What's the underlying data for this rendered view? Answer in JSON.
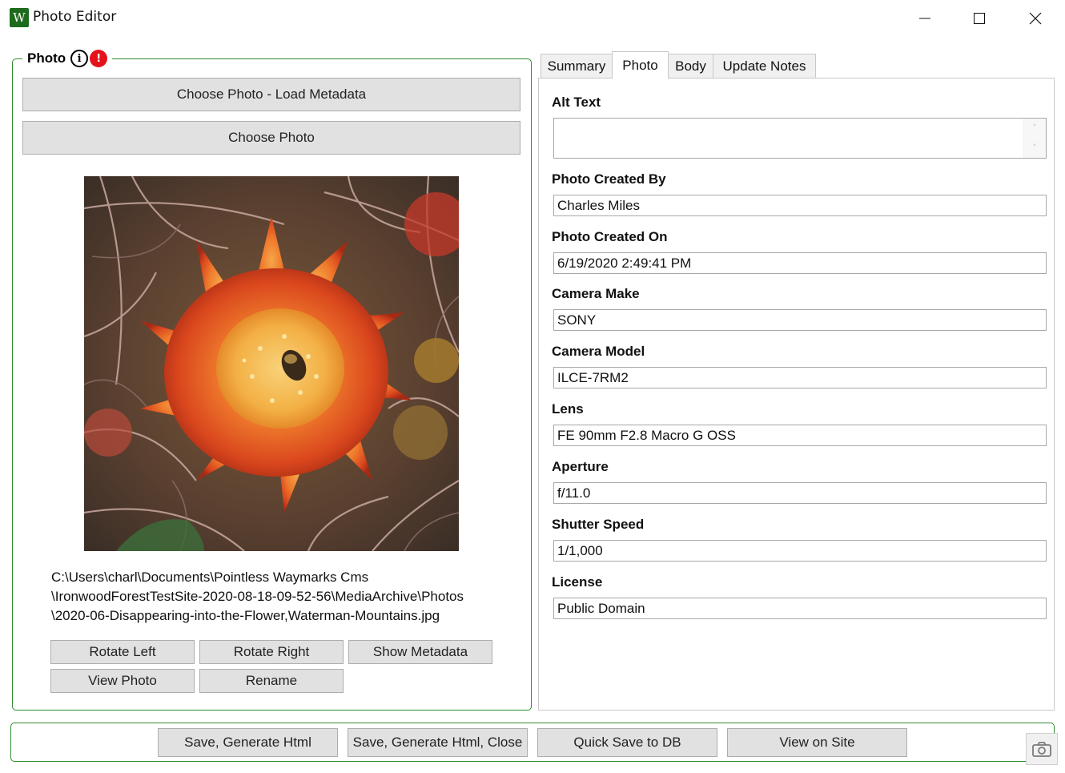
{
  "window": {
    "title": "Photo Editor",
    "icon_letter": "W",
    "icon_name": "app-logo-icon"
  },
  "photo_group": {
    "title": "Photo",
    "info_icon": "info-icon",
    "info_glyph": "i",
    "error_icon": "error-icon",
    "error_glyph": "!",
    "choose_load_metadata_label": "Choose Photo - Load Metadata",
    "choose_photo_label": "Choose Photo",
    "file_path_lines": [
      "C:\\Users\\charl\\Documents\\Pointless Waymarks Cms",
      "\\IronwoodForestTestSite-2020-08-18-09-52-56\\MediaArchive\\Photos",
      "\\2020-06-Disappearing-into-the-Flower,Waterman-Mountains.jpg"
    ],
    "buttons": {
      "rotate_left": "Rotate Left",
      "rotate_right": "Rotate Right",
      "show_metadata": "Show Metadata",
      "view_photo": "View Photo",
      "rename": "Rename"
    }
  },
  "tabs": [
    {
      "label": "Summary",
      "active": false
    },
    {
      "label": "Photo",
      "active": true
    },
    {
      "label": "Body",
      "active": false
    },
    {
      "label": "Update Notes",
      "active": false
    }
  ],
  "photo_tab": {
    "alt_text": {
      "label": "Alt Text",
      "value": ""
    },
    "created_by": {
      "label": "Photo Created By",
      "value": "Charles Miles"
    },
    "created_on": {
      "label": "Photo Created On",
      "value": "6/19/2020 2:49:41 PM"
    },
    "camera_make": {
      "label": "Camera Make",
      "value": "SONY"
    },
    "camera_model": {
      "label": "Camera Model",
      "value": "ILCE-7RM2"
    },
    "lens": {
      "label": "Lens",
      "value": "FE 90mm F2.8 Macro G OSS"
    },
    "aperture": {
      "label": "Aperture",
      "value": "f/11.0"
    },
    "shutter_speed": {
      "label": "Shutter Speed",
      "value": "1/1,000"
    },
    "license": {
      "label": "License",
      "value": "Public Domain"
    }
  },
  "bottom_bar": {
    "save_generate_html": "Save, Generate Html",
    "save_generate_html_close": "Save, Generate Html, Close",
    "quick_save_db": "Quick Save to DB",
    "view_on_site": "View on Site",
    "screenshot_icon": "camera-icon"
  },
  "colors": {
    "group_border": "#2f8a2f",
    "button_bg": "#e1e1e1",
    "error_red": "#e4131b"
  }
}
